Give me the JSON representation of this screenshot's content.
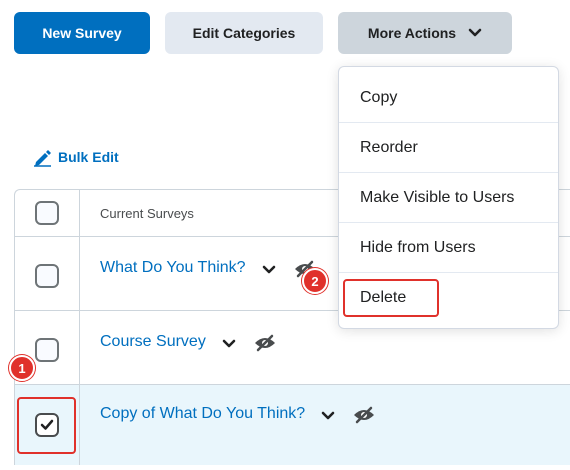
{
  "toolbar": {
    "new_survey": "New Survey",
    "edit_categories": "Edit Categories",
    "more_actions": "More Actions"
  },
  "bulk_edit": {
    "label": "Bulk Edit",
    "icon": "pencil-icon"
  },
  "table": {
    "header": "Current Surveys",
    "rows": [
      {
        "title": "What Do You Think?",
        "checked": false
      },
      {
        "title": "Course Survey",
        "checked": false
      },
      {
        "title": "Copy of What Do You Think?",
        "checked": true
      }
    ]
  },
  "dropdown": {
    "items": [
      {
        "label": "Copy"
      },
      {
        "label": "Reorder"
      },
      {
        "label": "Make Visible to Users"
      },
      {
        "label": "Hide from Users"
      },
      {
        "label": "Delete"
      }
    ]
  },
  "callouts": {
    "one": "1",
    "two": "2"
  },
  "colors": {
    "primary": "#006fbf",
    "callout": "#e0312b",
    "selected_row": "#e9f6fc"
  }
}
